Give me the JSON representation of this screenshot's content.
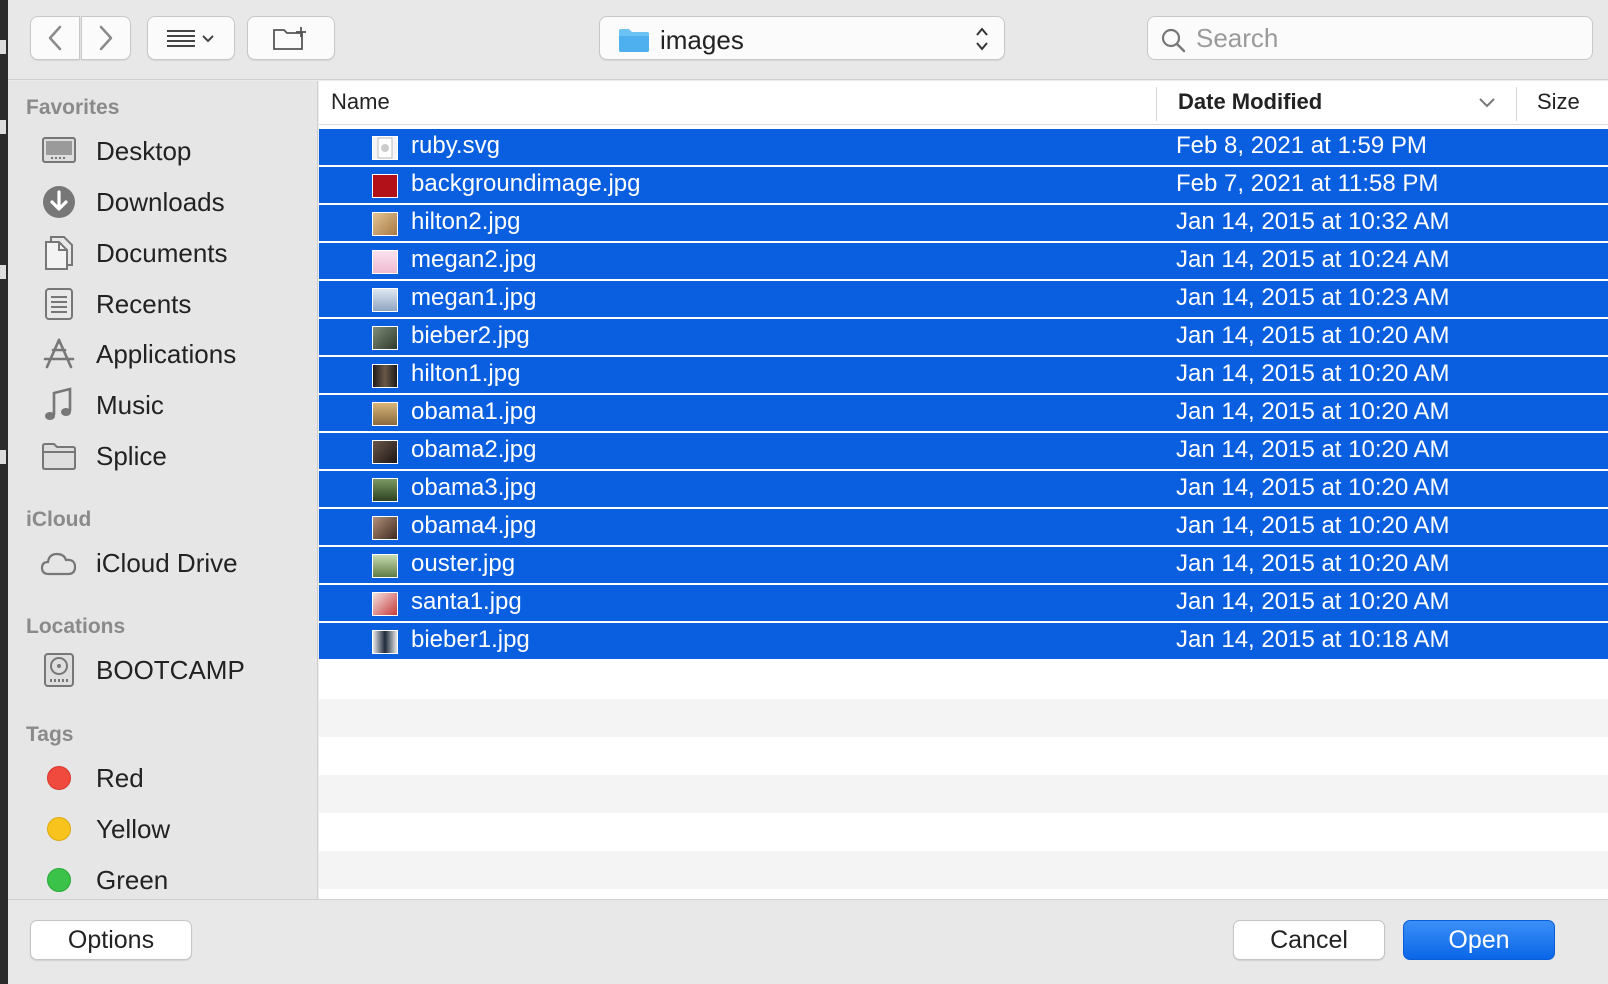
{
  "toolbar": {
    "location": "images",
    "search_placeholder": "Search"
  },
  "sidebar": {
    "favorites_label": "Favorites",
    "favorites": [
      {
        "label": "Desktop",
        "icon": "desktop-icon"
      },
      {
        "label": "Downloads",
        "icon": "downloads-icon"
      },
      {
        "label": "Documents",
        "icon": "documents-icon"
      },
      {
        "label": "Recents",
        "icon": "recents-icon"
      },
      {
        "label": "Applications",
        "icon": "applications-icon"
      },
      {
        "label": "Music",
        "icon": "music-icon"
      },
      {
        "label": "Splice",
        "icon": "folder-icon"
      }
    ],
    "icloud_label": "iCloud",
    "icloud": [
      {
        "label": "iCloud Drive",
        "icon": "cloud-icon"
      }
    ],
    "locations_label": "Locations",
    "locations": [
      {
        "label": "BOOTCAMP",
        "icon": "disk-icon"
      }
    ],
    "tags_label": "Tags",
    "tags": [
      {
        "label": "Red",
        "color": "#f04a3e"
      },
      {
        "label": "Yellow",
        "color": "#f8c31c"
      },
      {
        "label": "Green",
        "color": "#3ac348"
      }
    ]
  },
  "columns": {
    "name": "Name",
    "date_modified": "Date Modified",
    "size": "Size"
  },
  "files": [
    {
      "name": "ruby.svg",
      "date": "Feb 8, 2021 at 1:59 PM",
      "thumb": "#e9e9ee"
    },
    {
      "name": "backgroundimage.jpg",
      "date": "Feb 7, 2021 at 11:58 PM",
      "thumb": "#b3111a"
    },
    {
      "name": "hilton2.jpg",
      "date": "Jan 14, 2015 at 10:32 AM",
      "thumb": "#c9a36e"
    },
    {
      "name": "megan2.jpg",
      "date": "Jan 14, 2015 at 10:24 AM",
      "thumb": "#f2c6d8"
    },
    {
      "name": "megan1.jpg",
      "date": "Jan 14, 2015 at 10:23 AM",
      "thumb": "#b7c9e0"
    },
    {
      "name": "bieber2.jpg",
      "date": "Jan 14, 2015 at 10:20 AM",
      "thumb": "#4b5a48"
    },
    {
      "name": "hilton1.jpg",
      "date": "Jan 14, 2015 at 10:20 AM",
      "thumb": "#2c2622"
    },
    {
      "name": "obama1.jpg",
      "date": "Jan 14, 2015 at 10:20 AM",
      "thumb": "#c49a5a"
    },
    {
      "name": "obama2.jpg",
      "date": "Jan 14, 2015 at 10:20 AM",
      "thumb": "#3a2f2a"
    },
    {
      "name": "obama3.jpg",
      "date": "Jan 14, 2015 at 10:20 AM",
      "thumb": "#4f6b3d"
    },
    {
      "name": "obama4.jpg",
      "date": "Jan 14, 2015 at 10:20 AM",
      "thumb": "#7a5a4a"
    },
    {
      "name": "ouster.jpg",
      "date": "Jan 14, 2015 at 10:20 AM",
      "thumb": "#8aa56e"
    },
    {
      "name": "santa1.jpg",
      "date": "Jan 14, 2015 at 10:20 AM",
      "thumb": "#c73b3b"
    },
    {
      "name": "bieber1.jpg",
      "date": "Jan 14, 2015 at 10:18 AM",
      "thumb": "#1f2b3e"
    }
  ],
  "footer": {
    "options_label": "Options",
    "cancel_label": "Cancel",
    "open_label": "Open"
  },
  "colors": {
    "selection": "#0a5fe0",
    "primary_button": "#0a66e8"
  }
}
